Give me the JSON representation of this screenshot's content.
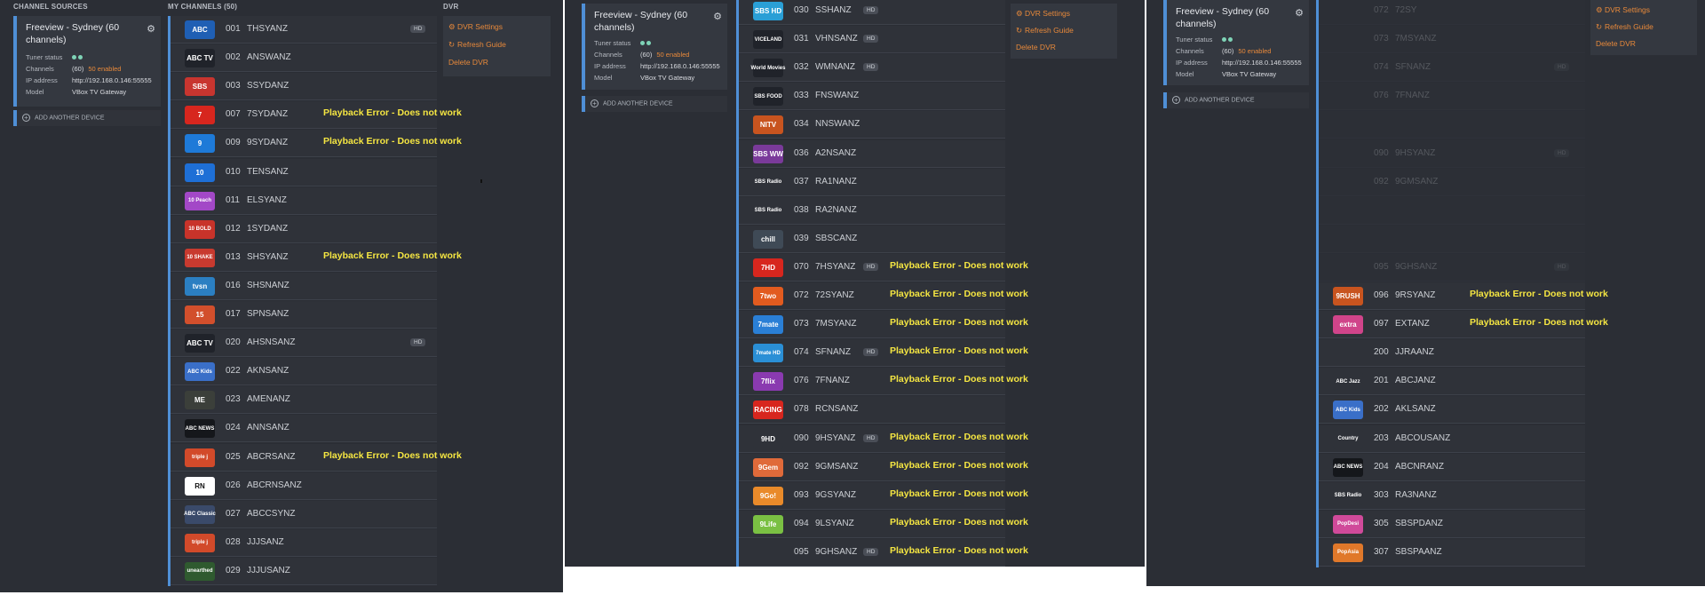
{
  "panel1": {
    "section_channel_sources": "CHANNEL SOURCES",
    "section_my_channels": "MY CHANNELS (50)",
    "section_dvr": "DVR"
  },
  "device": {
    "title": "Freeview - Sydney (60 channels)",
    "tuner_status_label": "Tuner status",
    "channels_label": "Channels",
    "channels_count": "(60)",
    "channels_enabled": "50 enabled",
    "ip_label": "IP address",
    "ip_value": "http://192.168.0.146:55555",
    "model_label": "Model",
    "model_value": "VBox TV Gateway",
    "add_device": "ADD ANOTHER DEVICE",
    "status_dot_color": "#7ed3b6"
  },
  "dvr": {
    "settings": "DVR Settings",
    "refresh": "Refresh Guide",
    "delete": "Delete DVR",
    "accent_color": "#e8893a"
  },
  "error_text": "Playback Error - Does not work",
  "hd_badge": "HD",
  "panel1_channels": [
    {
      "num": "001",
      "callsign": "THSYANZ",
      "logo": "ABC",
      "hd": true,
      "error": false
    },
    {
      "num": "002",
      "callsign": "ANSWANZ",
      "logo": "ABC TV",
      "hd": false,
      "error": false
    },
    {
      "num": "003",
      "callsign": "SSYDANZ",
      "logo": "SBS",
      "hd": false,
      "error": false
    },
    {
      "num": "007",
      "callsign": "7SYDANZ",
      "logo": "7",
      "hd": false,
      "error": true
    },
    {
      "num": "009",
      "callsign": "9SYDANZ",
      "logo": "9",
      "hd": false,
      "error": true
    },
    {
      "num": "010",
      "callsign": "TENSANZ",
      "logo": "10",
      "hd": false,
      "error": false
    },
    {
      "num": "011",
      "callsign": "ELSYANZ",
      "logo": "10 Peach",
      "hd": false,
      "error": false
    },
    {
      "num": "012",
      "callsign": "1SYDANZ",
      "logo": "10 BOLD",
      "hd": false,
      "error": false
    },
    {
      "num": "013",
      "callsign": "SHSYANZ",
      "logo": "10 SHAKE",
      "hd": false,
      "error": true
    },
    {
      "num": "016",
      "callsign": "SHSNANZ",
      "logo": "tvsn",
      "hd": false,
      "error": false
    },
    {
      "num": "017",
      "callsign": "SPNSANZ",
      "logo": "15",
      "hd": false,
      "error": false
    },
    {
      "num": "020",
      "callsign": "AHSNSANZ",
      "logo": "ABC TV",
      "hd": true,
      "error": false
    },
    {
      "num": "022",
      "callsign": "AKNSANZ",
      "logo": "ABC Kids",
      "hd": false,
      "error": false
    },
    {
      "num": "023",
      "callsign": "AMENANZ",
      "logo": "ME",
      "hd": false,
      "error": false
    },
    {
      "num": "024",
      "callsign": "ANNSANZ",
      "logo": "ABC NEWS",
      "hd": false,
      "error": false
    },
    {
      "num": "025",
      "callsign": "ABCRSANZ",
      "logo": "triple j",
      "hd": false,
      "error": true
    },
    {
      "num": "026",
      "callsign": "ABCRNSANZ",
      "logo": "RN",
      "hd": false,
      "error": false
    },
    {
      "num": "027",
      "callsign": "ABCCSYNZ",
      "logo": "ABC Classic",
      "hd": false,
      "error": false
    },
    {
      "num": "028",
      "callsign": "JJJSANZ",
      "logo": "triple j",
      "hd": false,
      "error": false
    },
    {
      "num": "029",
      "callsign": "JJJUSANZ",
      "logo": "unearthed",
      "hd": false,
      "error": false
    }
  ],
  "panel2_channels": [
    {
      "num": "030",
      "callsign": "SSHANZ",
      "logo": "SBS HD",
      "hd": true,
      "error": false
    },
    {
      "num": "031",
      "callsign": "VHNSANZ",
      "logo": "VICELAND",
      "hd": true,
      "error": false
    },
    {
      "num": "032",
      "callsign": "WMNANZ",
      "logo": "World Movies",
      "hd": true,
      "error": false
    },
    {
      "num": "033",
      "callsign": "FNSWANZ",
      "logo": "SBS FOOD",
      "hd": false,
      "error": false
    },
    {
      "num": "034",
      "callsign": "NNSWANZ",
      "logo": "NITV",
      "hd": false,
      "error": false
    },
    {
      "num": "036",
      "callsign": "A2NSANZ",
      "logo": "SBS WW",
      "hd": false,
      "error": false
    },
    {
      "num": "037",
      "callsign": "RA1NANZ",
      "logo": "SBS Radio",
      "hd": false,
      "error": false
    },
    {
      "num": "038",
      "callsign": "RA2NANZ",
      "logo": "SBS Radio",
      "hd": false,
      "error": false
    },
    {
      "num": "039",
      "callsign": "SBSCANZ",
      "logo": "chill",
      "hd": false,
      "error": false
    },
    {
      "num": "070",
      "callsign": "7HSYANZ",
      "logo": "7HD",
      "hd": true,
      "error": true
    },
    {
      "num": "072",
      "callsign": "72SYANZ",
      "logo": "7two",
      "hd": false,
      "error": true
    },
    {
      "num": "073",
      "callsign": "7MSYANZ",
      "logo": "7mate",
      "hd": false,
      "error": true
    },
    {
      "num": "074",
      "callsign": "SFNANZ",
      "logo": "7mate HD",
      "hd": true,
      "error": true
    },
    {
      "num": "076",
      "callsign": "7FNANZ",
      "logo": "7flix",
      "hd": false,
      "error": true
    },
    {
      "num": "078",
      "callsign": "RCNSANZ",
      "logo": "RACING",
      "hd": false,
      "error": false
    },
    {
      "num": "090",
      "callsign": "9HSYANZ",
      "logo": "9HD",
      "hd": true,
      "error": true
    },
    {
      "num": "092",
      "callsign": "9GMSANZ",
      "logo": "9Gem",
      "hd": false,
      "error": true
    },
    {
      "num": "093",
      "callsign": "9GSYANZ",
      "logo": "9Go!",
      "hd": false,
      "error": true
    },
    {
      "num": "094",
      "callsign": "9LSYANZ",
      "logo": "9Life",
      "hd": false,
      "error": true
    },
    {
      "num": "095",
      "callsign": "9GHSANZ",
      "logo": "",
      "hd": true,
      "error": true
    }
  ],
  "panel3_channels": [
    {
      "num": "072",
      "callsign": "72SY",
      "logo": "",
      "hd": false,
      "error": false,
      "faded": true
    },
    {
      "num": "073",
      "callsign": "7MSYANZ",
      "logo": "",
      "hd": false,
      "error": false,
      "faded": true
    },
    {
      "num": "074",
      "callsign": "SFNANZ",
      "logo": "",
      "hd": true,
      "error": false,
      "faded": true
    },
    {
      "num": "076",
      "callsign": "7FNANZ",
      "logo": "",
      "hd": false,
      "error": false,
      "faded": true
    },
    {
      "num": "",
      "callsign": "",
      "logo": "",
      "hd": false,
      "error": false,
      "faded": true
    },
    {
      "num": "090",
      "callsign": "9HSYANZ",
      "logo": "",
      "hd": true,
      "error": false,
      "faded": true
    },
    {
      "num": "092",
      "callsign": "9GMSANZ",
      "logo": "",
      "hd": false,
      "error": false,
      "faded": true
    },
    {
      "num": "",
      "callsign": "",
      "logo": "",
      "hd": false,
      "error": false,
      "faded": true
    },
    {
      "num": "",
      "callsign": "",
      "logo": "",
      "hd": false,
      "error": false,
      "faded": true
    },
    {
      "num": "095",
      "callsign": "9GHSANZ",
      "logo": "",
      "hd": true,
      "error": false,
      "faded": true
    },
    {
      "num": "096",
      "callsign": "9RSYANZ",
      "logo": "9RUSH",
      "hd": false,
      "error": true
    },
    {
      "num": "097",
      "callsign": "EXTANZ",
      "logo": "extra",
      "hd": false,
      "error": true
    },
    {
      "num": "200",
      "callsign": "JJRAANZ",
      "logo": "",
      "hd": false,
      "error": false
    },
    {
      "num": "201",
      "callsign": "ABCJANZ",
      "logo": "ABC Jazz",
      "hd": false,
      "error": false
    },
    {
      "num": "202",
      "callsign": "AKLSANZ",
      "logo": "ABC Kids",
      "hd": false,
      "error": false
    },
    {
      "num": "203",
      "callsign": "ABCOUSANZ",
      "logo": "Country",
      "hd": false,
      "error": false
    },
    {
      "num": "204",
      "callsign": "ABCNRANZ",
      "logo": "ABC NEWS",
      "hd": false,
      "error": false
    },
    {
      "num": "303",
      "callsign": "RA3NANZ",
      "logo": "SBS Radio",
      "hd": false,
      "error": false
    },
    {
      "num": "305",
      "callsign": "SBSPDANZ",
      "logo": "PopDesi",
      "hd": false,
      "error": false
    },
    {
      "num": "307",
      "callsign": "SBSPAANZ",
      "logo": "PopAsia",
      "hd": false,
      "error": false
    }
  ]
}
